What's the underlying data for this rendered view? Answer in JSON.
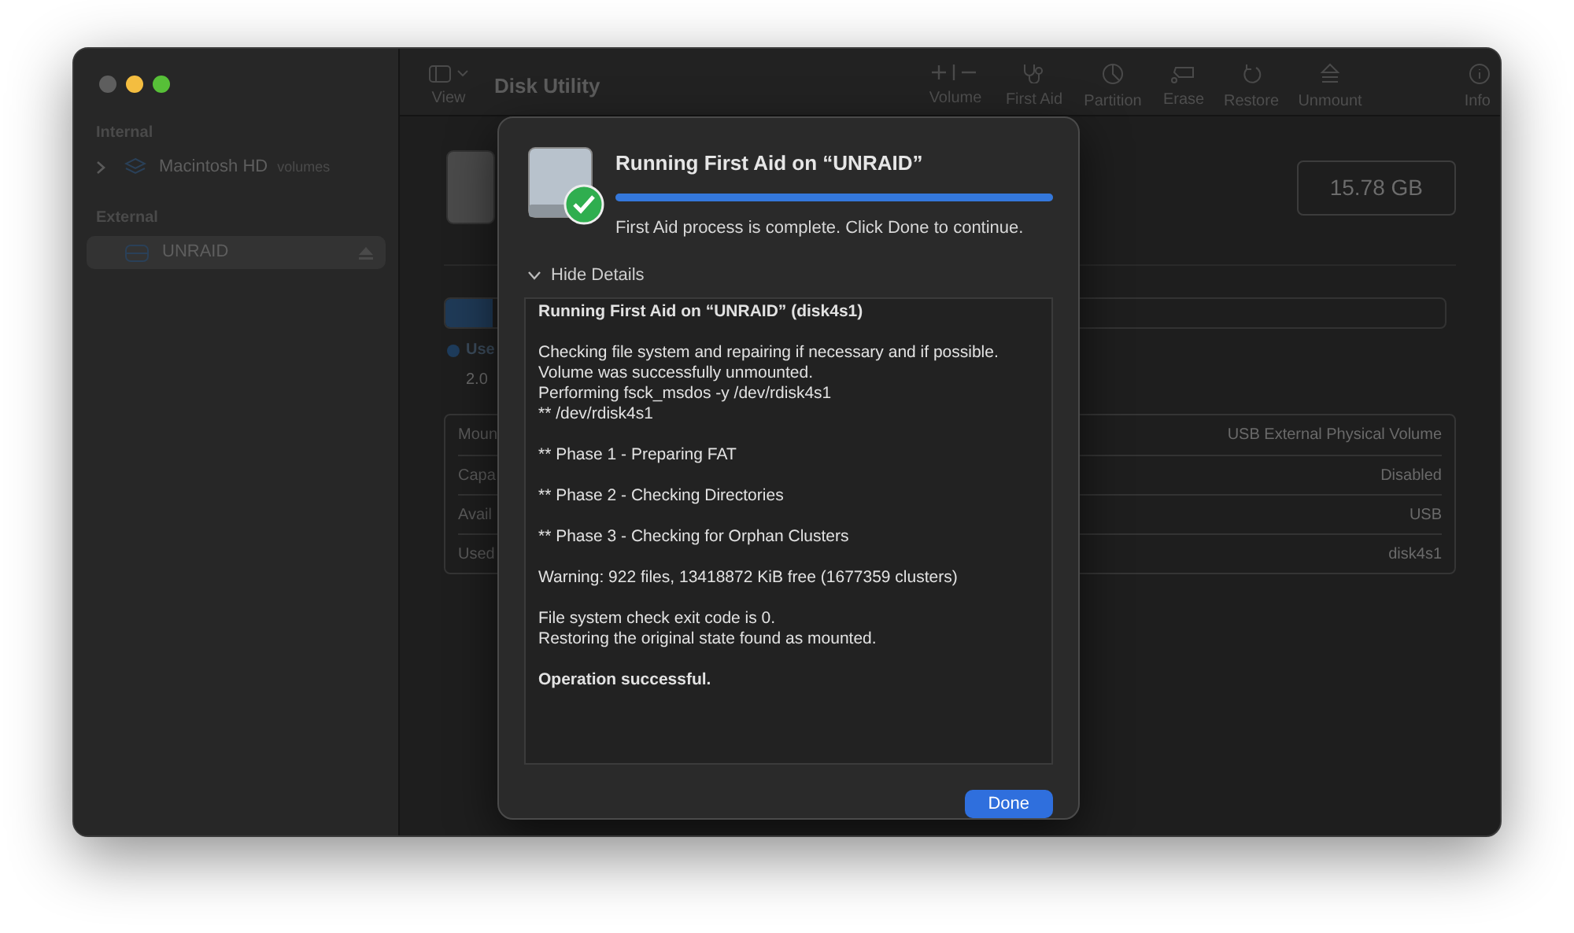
{
  "window": {
    "title": "Disk Utility"
  },
  "toolbar": {
    "view": "View",
    "items": [
      {
        "kind": "volume",
        "label": "Volume"
      },
      {
        "kind": "firstaid",
        "label": "First Aid"
      },
      {
        "kind": "partition",
        "label": "Partition"
      },
      {
        "kind": "erase",
        "label": "Erase"
      },
      {
        "kind": "restore",
        "label": "Restore"
      },
      {
        "kind": "unmount",
        "label": "Unmount"
      },
      {
        "kind": "info",
        "label": "Info"
      }
    ]
  },
  "sidebar": {
    "sections": [
      {
        "title": "Internal",
        "items": [
          {
            "kind": "stack",
            "name": "Macintosh HD",
            "note": "volumes",
            "expanded": false,
            "selected": false
          }
        ]
      },
      {
        "title": "External",
        "items": [
          {
            "kind": "drive",
            "name": "UNRAID",
            "eject": true,
            "selected": true
          }
        ]
      }
    ]
  },
  "main": {
    "capacity": "15.78 GB",
    "legend": "Use",
    "legend_value": "2.0",
    "info": [
      {
        "label": "Moun",
        "value": "USB External Physical Volume"
      },
      {
        "label": "Capa",
        "value": "Disabled"
      },
      {
        "label": "Avail",
        "value": "USB"
      },
      {
        "label": "Used",
        "value": "disk4s1"
      }
    ]
  },
  "dialog": {
    "title": "Running First Aid on “UNRAID”",
    "level": 1,
    "message": "First Aid process is complete. Click Done to continue.",
    "details_toggle": "Hide Details",
    "details_expanded": true,
    "log": [
      {
        "bold": true,
        "lines": [
          "Running First Aid on “UNRAID” (disk4s1)"
        ]
      },
      {
        "bold": false,
        "lines": [
          "Checking file system and repairing if necessary and if possible.",
          "Volume was successfully unmounted.",
          "Performing fsck_msdos -y /dev/rdisk4s1",
          "** /dev/rdisk4s1"
        ]
      },
      {
        "bold": false,
        "lines": [
          "** Phase 1 - Preparing FAT"
        ]
      },
      {
        "bold": false,
        "lines": [
          "** Phase 2 - Checking Directories"
        ]
      },
      {
        "bold": false,
        "lines": [
          "** Phase 3 - Checking for Orphan Clusters"
        ]
      },
      {
        "bold": false,
        "lines": [
          "Warning: 922 files, 13418872 KiB free (1677359 clusters)"
        ]
      },
      {
        "bold": false,
        "lines": [
          "File system check exit code is 0.",
          "Restoring the original state found as mounted."
        ]
      },
      {
        "bold": true,
        "lines": [
          "Operation successful."
        ]
      }
    ],
    "button": "Done"
  }
}
